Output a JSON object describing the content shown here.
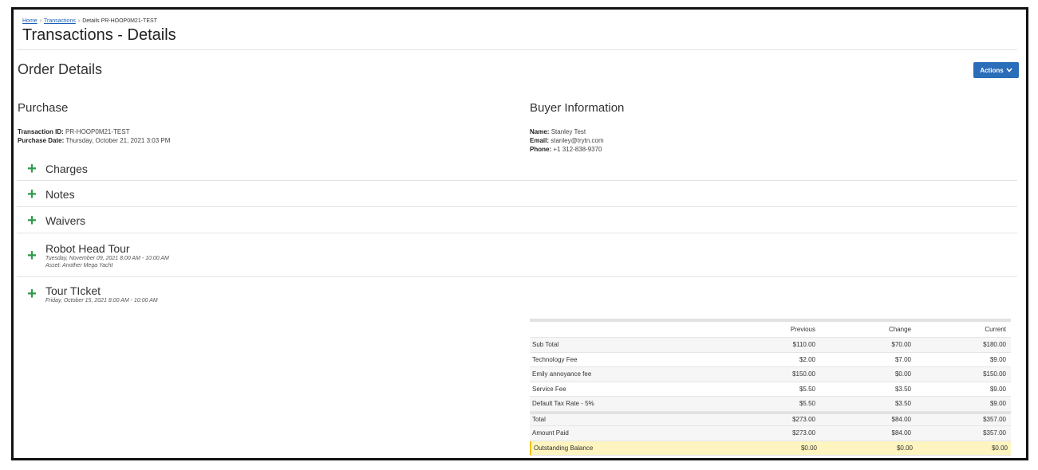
{
  "breadcrumb": {
    "home": "Home",
    "transactions": "Transactions",
    "current": "Details PR-HOOP0M21-TEST"
  },
  "page_title": "Transactions - Details",
  "order_title": "Order Details",
  "actions_label": "Actions",
  "purchase": {
    "title": "Purchase",
    "transaction_id_label": "Transaction ID:",
    "transaction_id": "PR-HOOP0M21-TEST",
    "purchase_date_label": "Purchase Date:",
    "purchase_date": "Thursday, October 21, 2021 3:03 PM"
  },
  "buyer": {
    "title": "Buyer Information",
    "name_label": "Name:",
    "name": "Stanley Test",
    "email_label": "Email:",
    "email": "stanley@trytn.com",
    "phone_label": "Phone:",
    "phone": "+1 312-838-9370"
  },
  "sections": {
    "charges": "Charges",
    "notes": "Notes",
    "waivers": "Waivers"
  },
  "items": [
    {
      "title": "Robot Head Tour",
      "date": "Tuesday, November 09, 2021 8:00 AM - 10:00 AM",
      "asset": "Asset: Another Mega Yacht"
    },
    {
      "title": "Tour TIcket",
      "date": "Friday, October 15, 2021 8:00 AM - 10:00 AM"
    }
  ],
  "summary": {
    "headers": [
      "",
      "Previous",
      "Change",
      "Current"
    ],
    "rows": [
      {
        "label": "Sub Total",
        "previous": "$110.00",
        "change": "$70.00",
        "current": "$180.00"
      },
      {
        "label": "Technology Fee",
        "previous": "$2.00",
        "change": "$7.00",
        "current": "$9.00"
      },
      {
        "label": "Emily annoyance fee",
        "previous": "$150.00",
        "change": "$0.00",
        "current": "$150.00"
      },
      {
        "label": "Service Fee",
        "previous": "$5.50",
        "change": "$3.50",
        "current": "$9.00"
      },
      {
        "label": "Default Tax Rate - 5%",
        "previous": "$5.50",
        "change": "$3.50",
        "current": "$9.00"
      },
      {
        "label": "Total",
        "previous": "$273.00",
        "change": "$84.00",
        "current": "$357.00"
      },
      {
        "label": "Amount Paid",
        "previous": "$273.00",
        "change": "$84.00",
        "current": "$357.00"
      },
      {
        "label": "Outstanding Balance",
        "previous": "$0.00",
        "change": "$0.00",
        "current": "$0.00"
      }
    ]
  },
  "colors": {
    "accent": "#2a6db9",
    "plus": "#2e9b4a",
    "balance_highlight": "#fdf4bf"
  }
}
